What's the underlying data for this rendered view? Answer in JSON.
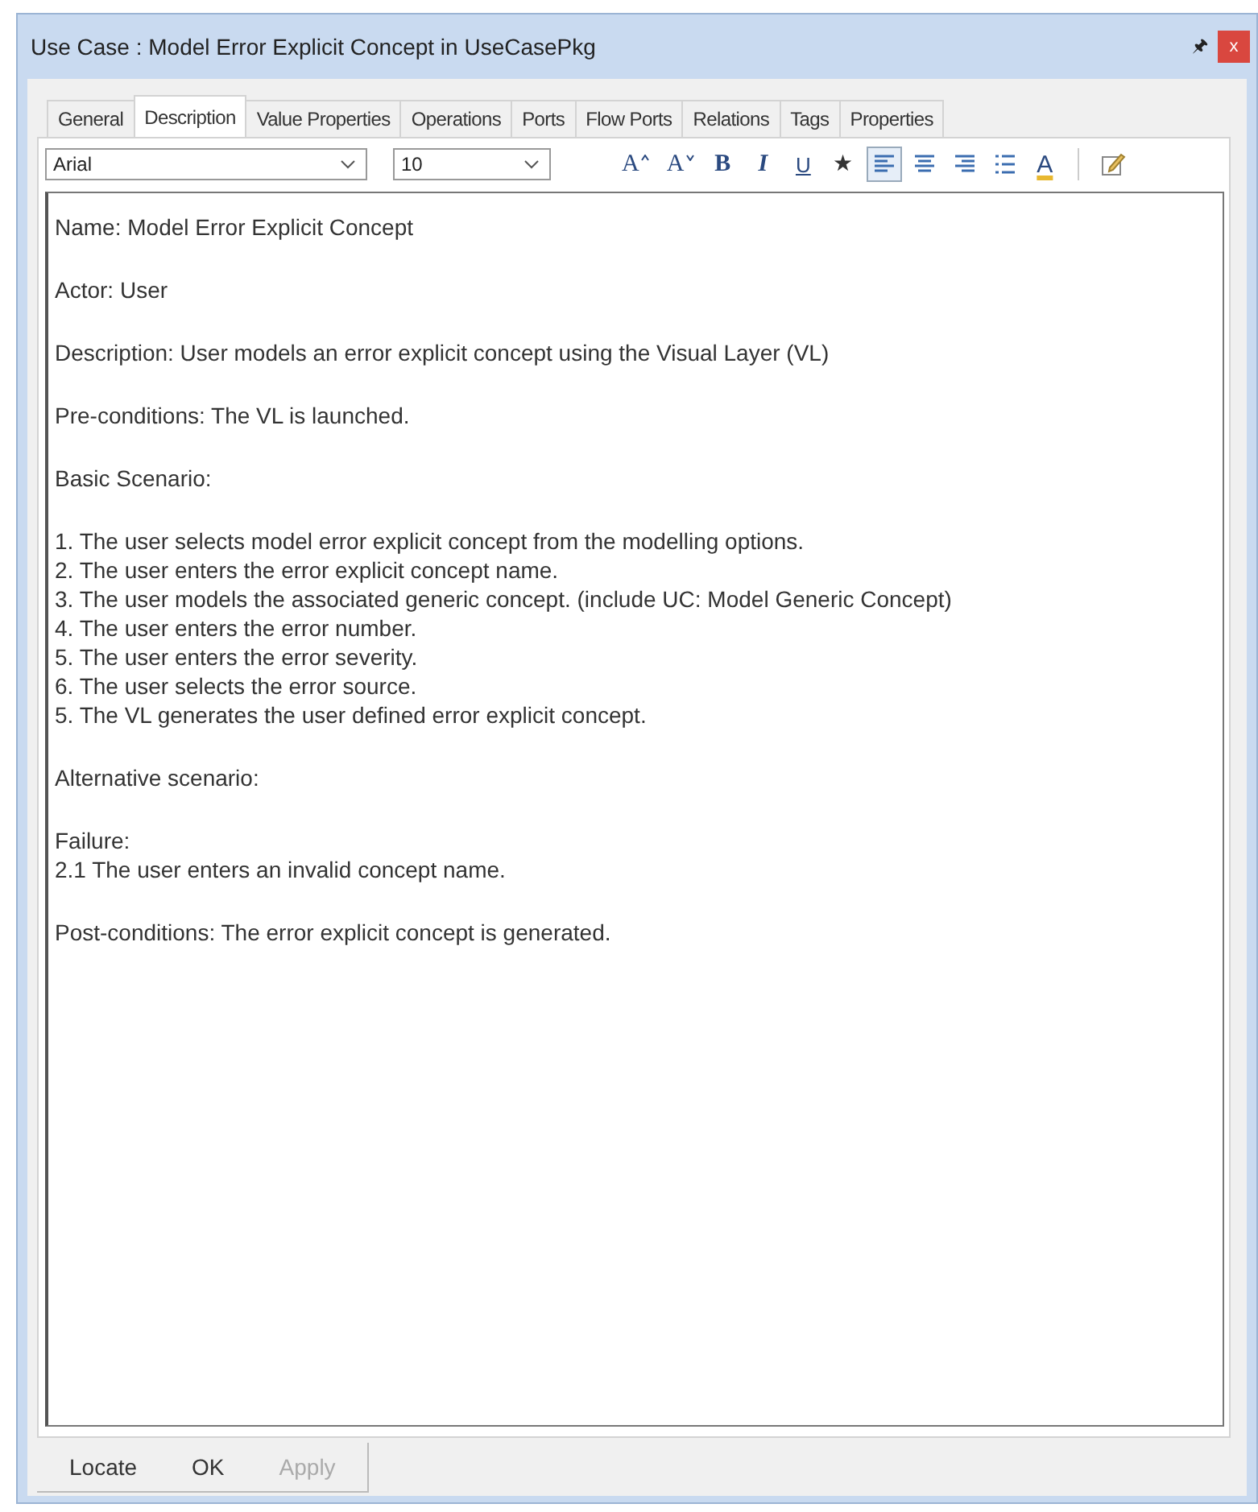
{
  "window": {
    "title": "Use Case : Model Error Explicit Concept in UseCasePkg",
    "pin": "🖈",
    "close": "x"
  },
  "tabs": [
    {
      "label": "General",
      "selected": false
    },
    {
      "label": "Description",
      "selected": true
    },
    {
      "label": "Value Properties",
      "selected": false
    },
    {
      "label": "Operations",
      "selected": false
    },
    {
      "label": "Ports",
      "selected": false
    },
    {
      "label": "Flow Ports",
      "selected": false
    },
    {
      "label": "Relations",
      "selected": false
    },
    {
      "label": "Tags",
      "selected": false
    },
    {
      "label": "Properties",
      "selected": false
    }
  ],
  "toolbar": {
    "font": "Arial",
    "size": "10",
    "tools": [
      {
        "kind": "grow",
        "label": "A",
        "selected": false
      },
      {
        "kind": "shrink",
        "label": "A",
        "selected": false
      },
      {
        "kind": "bold",
        "label": "B",
        "selected": false
      },
      {
        "kind": "italic",
        "label": "I",
        "selected": false
      },
      {
        "kind": "underline",
        "label": "U",
        "selected": false
      },
      {
        "kind": "strike",
        "label": "★",
        "selected": false
      },
      {
        "kind": "align-left",
        "selected": true
      },
      {
        "kind": "align-center",
        "selected": false
      },
      {
        "kind": "align-right",
        "selected": false
      },
      {
        "kind": "bullets",
        "selected": false
      },
      {
        "kind": "color",
        "label": "A",
        "selected": false
      },
      {
        "kind": "edit",
        "selected": false
      }
    ]
  },
  "description": [
    {
      "kind": "para",
      "lines": [
        "Name: Model Error Explicit Concept"
      ]
    },
    {
      "kind": "para",
      "lines": [
        "Actor: User"
      ]
    },
    {
      "kind": "para",
      "lines": [
        "Description: User models an error explicit concept using the Visual Layer (VL)"
      ]
    },
    {
      "kind": "para",
      "lines": [
        "Pre-conditions: The VL is launched."
      ]
    },
    {
      "kind": "para",
      "lines": [
        "Basic Scenario:"
      ]
    },
    {
      "kind": "para",
      "lines": [
        "1. The user selects model error explicit concept from the modelling options.",
        "2. The user enters the error explicit concept name.",
        "3. The user models the associated generic concept. (include UC: Model Generic Concept)",
        "4. The user enters the error number.",
        "5. The user enters the error severity.",
        "6. The user selects the error source.",
        "5. The VL generates the user defined error explicit concept."
      ]
    },
    {
      "kind": "para",
      "lines": [
        "Alternative scenario:"
      ]
    },
    {
      "kind": "para",
      "lines": [
        "Failure:",
        "2.1 The user enters an invalid concept name."
      ]
    },
    {
      "kind": "break-para",
      "lines": [
        "Post-conditions: The error explicit concept is generated."
      ]
    }
  ],
  "buttons": [
    {
      "label": "Locate",
      "disabled": false
    },
    {
      "label": "OK",
      "disabled": false
    },
    {
      "label": "Apply",
      "disabled": true
    }
  ]
}
